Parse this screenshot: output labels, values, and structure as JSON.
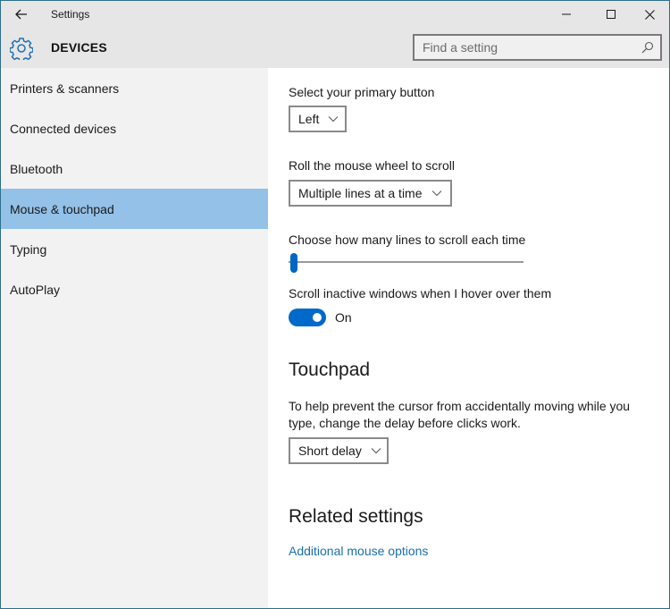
{
  "titlebar": {
    "title": "Settings",
    "back_icon": "arrow-left-icon",
    "controls": [
      "minimize-icon",
      "maximize-icon",
      "close-icon"
    ]
  },
  "header": {
    "icon": "gear-icon",
    "title": "DEVICES",
    "search": {
      "placeholder": "Find a setting",
      "value": "",
      "icon": "search-icon"
    }
  },
  "sidebar": {
    "items": [
      {
        "label": "Printers & scanners",
        "selected": false
      },
      {
        "label": "Connected devices",
        "selected": false
      },
      {
        "label": "Bluetooth",
        "selected": false
      },
      {
        "label": "Mouse & touchpad",
        "selected": true
      },
      {
        "label": "Typing",
        "selected": false
      },
      {
        "label": "AutoPlay",
        "selected": false
      }
    ]
  },
  "main": {
    "primary_button": {
      "label": "Select your primary button",
      "value": "Left"
    },
    "wheel_scroll": {
      "label": "Roll the mouse wheel to scroll",
      "value": "Multiple lines at a time"
    },
    "lines_slider": {
      "label": "Choose how many lines to scroll each time",
      "position_fraction": 0.0
    },
    "inactive_scroll": {
      "label": "Scroll inactive windows when I hover over them",
      "state": "On",
      "on": true
    },
    "touchpad": {
      "heading": "Touchpad",
      "description": "To help prevent the cursor from accidentally moving while you type, change the delay before clicks work.",
      "delay_value": "Short delay"
    },
    "related": {
      "heading": "Related settings",
      "link": "Additional mouse options"
    }
  },
  "colors": {
    "accent": "#0069c9",
    "selected_nav": "#93c1e8",
    "link": "#1a70a8",
    "window_border": "#2d6e8c"
  }
}
